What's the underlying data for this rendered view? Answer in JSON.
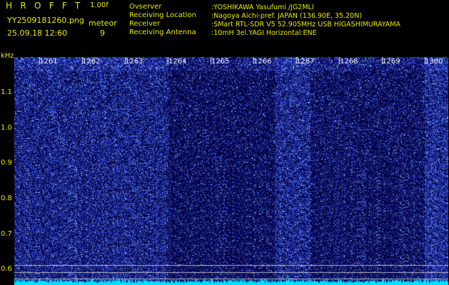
{
  "app": {
    "title": "HROFFT",
    "version": "1.00f"
  },
  "image": {
    "filename": "YY2509181260.png",
    "datetime": "25.09.18 12:60"
  },
  "meteor": {
    "label": "meteor",
    "count": "9"
  },
  "station_info": [
    {
      "label": "Ovserver",
      "value": ":YOSHIKAWA Yasufumi /JG2MLI"
    },
    {
      "label": "Receiving Location",
      "value": ":Nagoya Aichi-pref. JAPAN (136.90E, 35.20N)"
    },
    {
      "label": "Receiver",
      "value": ":SMart RTL-SDR V5 52.905MHz USB HIGASHIMURAYAMA"
    },
    {
      "label": "Receiving Antenna",
      "value": ":10mH 3el.YAGI Horizontal:ENE"
    }
  ],
  "colors": {
    "text": "#e8e800",
    "background": "#000000",
    "spectrogram": "#0a0a8a",
    "noise_floor": "#00e0ff"
  },
  "spectrogram": {
    "unit": "kHz",
    "y_ticks": [
      "1.1",
      "1.0",
      "0.9",
      "0.8",
      "0.7",
      "0.6"
    ],
    "x_ticks": [
      "1261",
      "1262",
      "1263",
      "1264",
      "1265",
      "1266",
      "1267",
      "1268",
      "1269",
      "1300"
    ]
  }
}
